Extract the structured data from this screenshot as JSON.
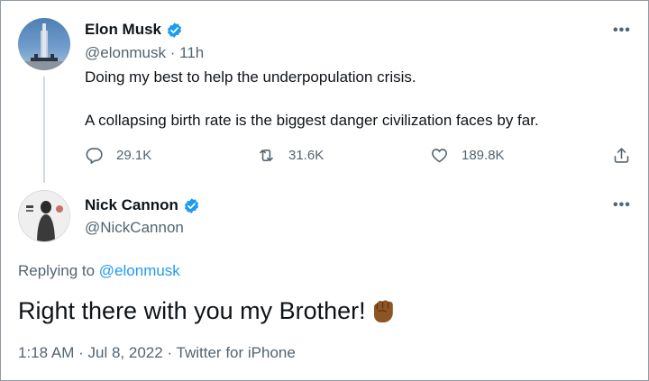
{
  "tweet1": {
    "name": "Elon Musk",
    "handle": "@elonmusk",
    "separator": "·",
    "time": "11h",
    "line1": "Doing my best to help the underpopulation crisis.",
    "line2": "A collapsing birth rate is the biggest danger civilization faces by far.",
    "replies": "29.1K",
    "retweets": "31.6K",
    "likes": "189.8K",
    "more": "•••"
  },
  "tweet2": {
    "name": "Nick Cannon",
    "handle": "@NickCannon",
    "more": "•••",
    "replying_prefix": "Replying to",
    "replying_handle": "@elonmusk",
    "text": "Right there with you my Brother!",
    "time": "1:18 AM",
    "date": "Jul 8, 2022",
    "source": "Twitter for iPhone",
    "separator": "·"
  },
  "colors": {
    "verified": "#1d9bf0",
    "link": "#1d9bf0",
    "muted": "#536471",
    "fist": "#8d5524"
  },
  "icons": [
    "reply-icon",
    "retweet-icon",
    "like-icon",
    "share-icon",
    "verified-badge-icon",
    "raised-fist-icon"
  ]
}
